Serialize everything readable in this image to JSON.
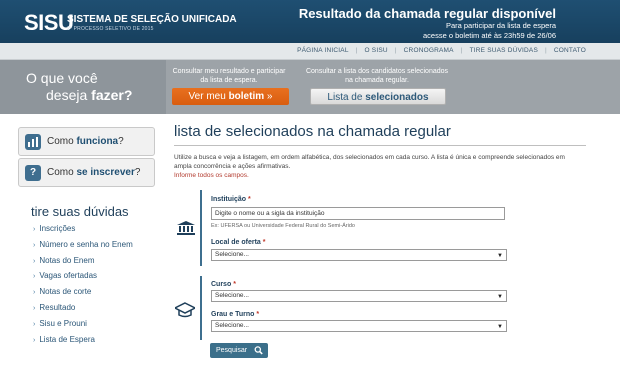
{
  "header": {
    "brand": "SISU",
    "brand_subtitle": "SISTEMA DE SELEÇÃO UNIFICADA",
    "brand_process": "2º PROCESSO SELETIVO DE 2015",
    "notice_title": "Resultado da chamada regular disponível",
    "notice_line1": "Para participar da lista de espera",
    "notice_line2": "acesse o boletim até às 23h59 de 26/06"
  },
  "nav": {
    "items": [
      "PÁGINA INICIAL",
      "O SISU",
      "CRONOGRAMA",
      "TIRE SUAS DÚVIDAS",
      "CONTATO"
    ]
  },
  "banner": {
    "question_line1": "O que você",
    "question_line2_a": "deseja ",
    "question_line2_b": "fazer?",
    "text_left": "Consultar meu resultado e participar da lista de espera.",
    "text_right": "Consultar a lista dos candidatos selecionados na chamada regular.",
    "btn_boletim_a": "Ver meu ",
    "btn_boletim_b": "boletim",
    "btn_boletim_arrow": "»",
    "btn_lista_a": "Lista de ",
    "btn_lista_b": "selecionados"
  },
  "sidebar": {
    "box1_a": "Como ",
    "box1_b": "funciona",
    "box1_c": "?",
    "box2_a": "Como ",
    "box2_b": "se inscrever",
    "box2_c": "?",
    "faq_title": "tire suas dúvidas",
    "faq_items": [
      "Inscrições",
      "Número e senha no Enem",
      "Notas do Enem",
      "Vagas ofertadas",
      "Notas de corte",
      "Resultado",
      "Sisu e Prouni",
      "Lista de Espera"
    ]
  },
  "main": {
    "title": "lista de selecionados na chamada regular",
    "intro": "Utilize a busca e veja a listagem, em ordem alfabética, dos selecionados em cada curso. A lista é única e compreende selecionados em ampla concorrência e ações afirmativas.",
    "required_note": "Informe todos os campos.",
    "instituicao_label": "Instituição",
    "instituicao_placeholder": "Digite o nome ou a sigla da instituição",
    "instituicao_hint": "Ex: UFERSA ou Universidade Federal Rural do Semi-Árido",
    "local_label": "Local de oferta",
    "local_value": "Selecione...",
    "curso_label": "Curso",
    "curso_value": "Selecione...",
    "grau_label": "Grau e Turno",
    "grau_value": "Selecione...",
    "required_mark": "*",
    "search_button": "Pesquisar"
  }
}
